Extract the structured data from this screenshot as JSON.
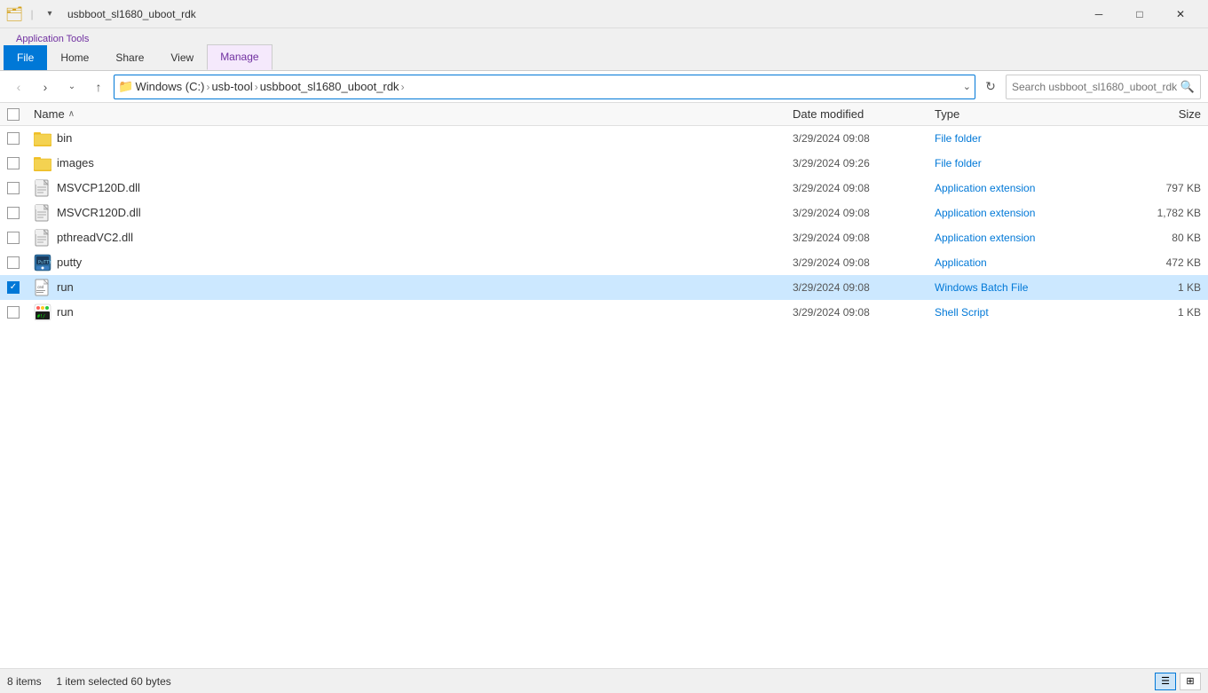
{
  "titleBar": {
    "title": "usbboot_sl1680_uboot_rdk",
    "minimize": "─",
    "maximize": "□",
    "close": "✕"
  },
  "ribbon": {
    "tabs": [
      {
        "id": "file",
        "label": "File",
        "active": true,
        "style": "file"
      },
      {
        "id": "home",
        "label": "Home",
        "active": false,
        "style": "normal"
      },
      {
        "id": "share",
        "label": "Share",
        "active": false,
        "style": "normal"
      },
      {
        "id": "view",
        "label": "View",
        "active": false,
        "style": "normal"
      },
      {
        "id": "manage",
        "label": "Manage",
        "active": true,
        "style": "manage"
      }
    ],
    "manageLabel": "Application Tools"
  },
  "addressBar": {
    "back": "‹",
    "forward": "›",
    "recent": "⌄",
    "up": "↑",
    "breadcrumb": [
      {
        "label": "Windows (C:)",
        "sep": "›"
      },
      {
        "label": "usb-tool",
        "sep": "›"
      },
      {
        "label": "usbboot_sl1680_uboot_rdk",
        "sep": "›"
      }
    ],
    "refresh": "↻",
    "searchPlaceholder": "Search usbboot_sl1680_uboot_rdk"
  },
  "fileList": {
    "headers": {
      "name": "Name",
      "dateModified": "Date modified",
      "type": "Type",
      "size": "Size",
      "sortArrow": "∧"
    },
    "files": [
      {
        "id": "bin",
        "name": "bin",
        "dateModified": "3/29/2024 09:08",
        "type": "File folder",
        "size": "",
        "iconType": "folder",
        "selected": false
      },
      {
        "id": "images",
        "name": "images",
        "dateModified": "3/29/2024 09:26",
        "type": "File folder",
        "size": "",
        "iconType": "folder",
        "selected": false
      },
      {
        "id": "msvcp120d",
        "name": "MSVCP120D.dll",
        "dateModified": "3/29/2024 09:08",
        "type": "Application extension",
        "size": "797 KB",
        "iconType": "dll",
        "selected": false
      },
      {
        "id": "msvcr120d",
        "name": "MSVCR120D.dll",
        "dateModified": "3/29/2024 09:08",
        "type": "Application extension",
        "size": "1,782 KB",
        "iconType": "dll",
        "selected": false
      },
      {
        "id": "pthreadvc2",
        "name": "pthreadVC2.dll",
        "dateModified": "3/29/2024 09:08",
        "type": "Application extension",
        "size": "80 KB",
        "iconType": "dll",
        "selected": false
      },
      {
        "id": "putty",
        "name": "putty",
        "dateModified": "3/29/2024 09:08",
        "type": "Application",
        "size": "472 KB",
        "iconType": "app",
        "selected": false
      },
      {
        "id": "run-bat",
        "name": "run",
        "dateModified": "3/29/2024 09:08",
        "type": "Windows Batch File",
        "size": "1 KB",
        "iconType": "batch",
        "selected": true
      },
      {
        "id": "run-sh",
        "name": "run",
        "dateModified": "3/29/2024 09:08",
        "type": "Shell Script",
        "size": "1 KB",
        "iconType": "shell",
        "selected": false
      }
    ]
  },
  "statusBar": {
    "itemCount": "8 items",
    "selectedInfo": "1 item selected  60 bytes"
  }
}
